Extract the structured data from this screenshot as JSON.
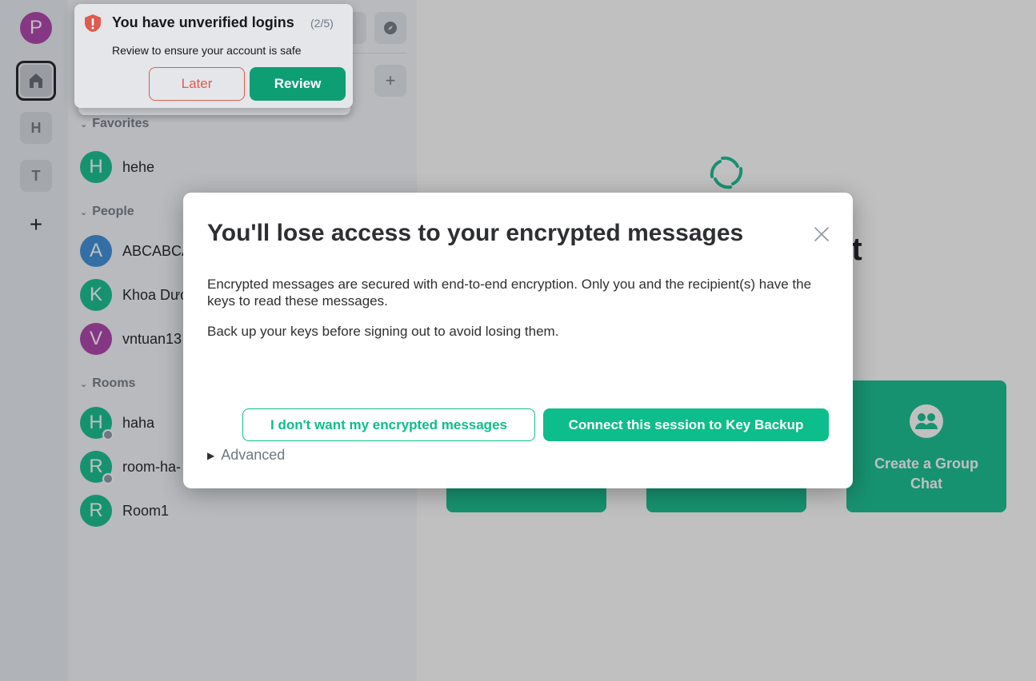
{
  "spaces": {
    "user_initial": "P",
    "items": [
      {
        "initial": "H"
      },
      {
        "initial": "T"
      }
    ],
    "add_label": "+"
  },
  "room_list": {
    "add_label": "+",
    "sections": {
      "favorites": "Favorites",
      "people": "People",
      "rooms": "Rooms"
    },
    "favorites": [
      {
        "initial": "H",
        "name": "hehe",
        "color": "#0dbd8b"
      }
    ],
    "people": [
      {
        "initial": "A",
        "name": "ABCABCA",
        "color": "#368bd6"
      },
      {
        "initial": "K",
        "name": "Khoa Dươ",
        "color": "#0dbd8b"
      },
      {
        "initial": "V",
        "name": "vntuan13",
        "color": "#ac3ba8"
      }
    ],
    "rooms": [
      {
        "initial": "H",
        "name": "haha",
        "color": "#0dbd8b"
      },
      {
        "initial": "R",
        "name": "room-ha-",
        "color": "#0dbd8b"
      },
      {
        "initial": "R",
        "name": "Room1",
        "color": "#0dbd8b"
      }
    ]
  },
  "home": {
    "welcome_partial": "nt",
    "tiles": [
      {
        "label": "Create a Group Chat",
        "icon": "group-icon"
      }
    ]
  },
  "toast": {
    "title": "You have unverified logins",
    "count": "(2/5)",
    "description": "Review to ensure your account is safe",
    "later_label": "Later",
    "review_label": "Review",
    "icon": "shield-alert-icon"
  },
  "dialog": {
    "title": "You'll lose access to your encrypted messages",
    "paragraph1": "Encrypted messages are secured with end-to-end encryption. Only you and the recipient(s) have the keys to read these messages.",
    "paragraph2": "Back up your keys before signing out to avoid losing them.",
    "decline_label": "I don't want my encrypted messages",
    "connect_label": "Connect this session to Key Backup",
    "advanced_label": "Advanced",
    "close_icon": "close-icon"
  },
  "colors": {
    "accent": "#0dbd8b",
    "alert": "#e05a50"
  }
}
